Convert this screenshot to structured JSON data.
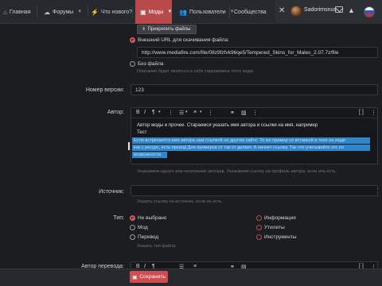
{
  "nav": {
    "items": [
      {
        "icon": "⌂",
        "label": "Главная"
      },
      {
        "icon": "☁",
        "label": "Форумы"
      },
      {
        "icon": "⚡",
        "label": "Что нового?"
      },
      {
        "icon": "▣",
        "label": "Моды"
      },
      {
        "icon": "👥",
        "label": "Пользователи"
      },
      {
        "icon": "",
        "label": "Сообщества"
      }
    ],
    "username": "Sadorimsnus"
  },
  "form": {
    "attach_button": "Прикрепить файлы",
    "external_url_label": "Внешний URL для скачивания файла:",
    "external_url_value": "http://www.mediafire.com/file/08z9fzfvk96qe5/Tempered_Skins_for_Males_2.07.7z/file",
    "no_file_label": "Без файла",
    "no_file_hint": "Описание будет являться в себя содержимое этого мода.",
    "version_label": "Номер версии:",
    "version_value": "123",
    "author_label": "Автор:",
    "author_text_1": "Автор моды и прочее. Стараемся указать имя автора и ссылки на имя, например",
    "author_text_2": "Тест",
    "author_sel_1": "Если встречается имя автора нам ссылкой на другом сайте. То же пример со вставкой в теле на моде",
    "author_sel_2": "как с ресурс, есть превод Для примеров от так от делает. А начнет ссылку. Так что учитывайте это по",
    "author_sel_3": "возможности.",
    "author_hint": "Указываем одного или нескольких авторов. Указываем ссылку на профиль автора, если она есть.",
    "source_label": "Источник:",
    "source_hint": "Указать ссылку на источник, если он есть.",
    "type_label": "Тип:",
    "types_left": [
      "Не выбрано",
      "Мод",
      "Перевод"
    ],
    "types_right": [
      "Информация",
      "Утилиты",
      "Инструменты"
    ],
    "type_hint": "Указать тип файла.",
    "translator_label": "Автор перевода:",
    "save_button": "Сохранить"
  },
  "colors": {
    "accent": "#b84a4b",
    "selection": "#2f86c8"
  },
  "icons": [
    "home-icon",
    "forum-icon",
    "whats-new-icon",
    "mods-icon",
    "users-icon",
    "tools-icon",
    "mail-icon",
    "bell-icon",
    "flag-icon",
    "paperclip-icon",
    "save-icon"
  ]
}
